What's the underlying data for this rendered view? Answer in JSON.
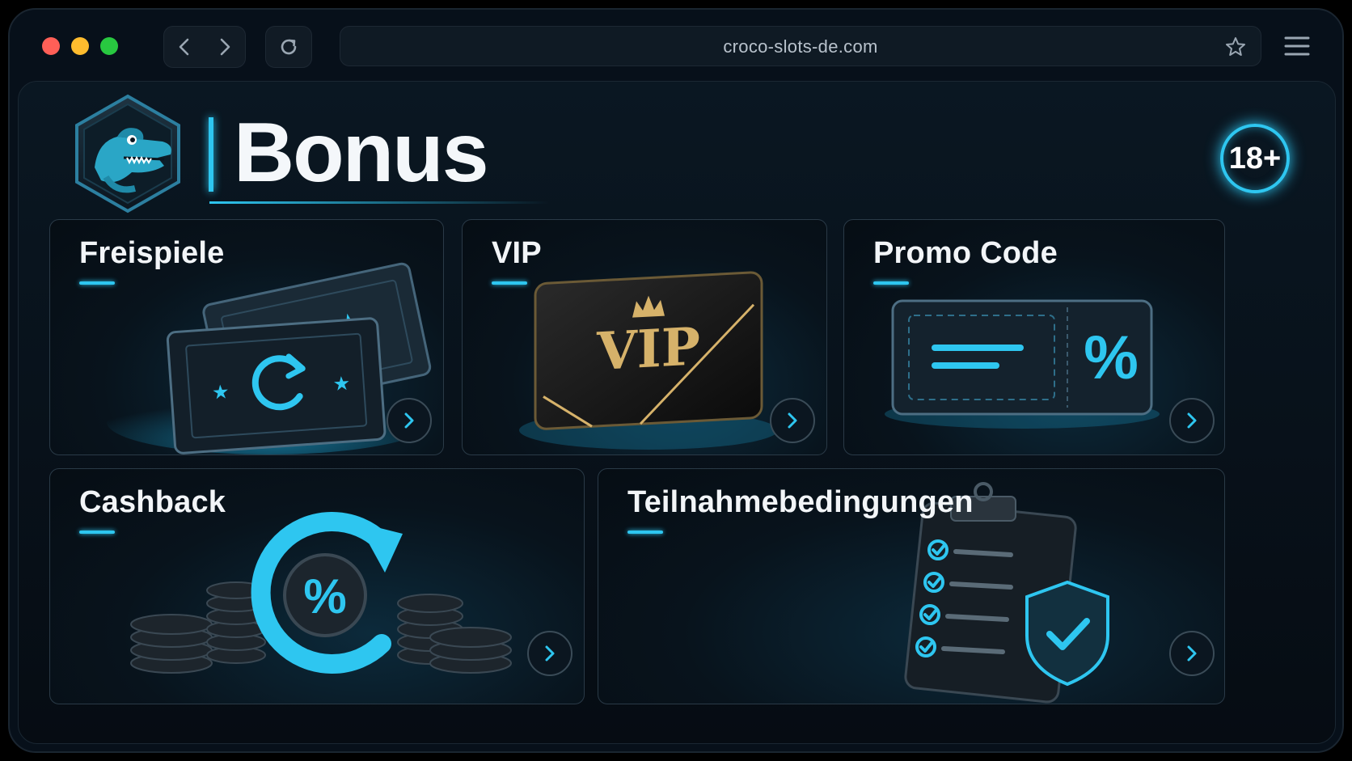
{
  "browser": {
    "url": "croco-slots-de.com",
    "icons": [
      "back-icon",
      "forward-icon",
      "reload-icon",
      "star-icon",
      "menu-icon"
    ]
  },
  "header": {
    "title": "Bonus",
    "age_badge": "18+",
    "logo": "crocodile-logo"
  },
  "cards": [
    {
      "title": "Freispiele",
      "art": "tickets-icon"
    },
    {
      "title": "VIP",
      "art": "vip-card",
      "card_text": "VIP"
    },
    {
      "title": "Promo Code",
      "art": "promo-ticket",
      "ticket_text": "%"
    },
    {
      "title": "Cashback",
      "art": "cashback-coins",
      "coin_text": "%"
    },
    {
      "title": "Teilnahmebedingungen",
      "art": "clipboard-shield"
    }
  ],
  "colors": {
    "accent": "#2ec6f0",
    "background": "#07101a",
    "gold": "#d6b26a"
  }
}
